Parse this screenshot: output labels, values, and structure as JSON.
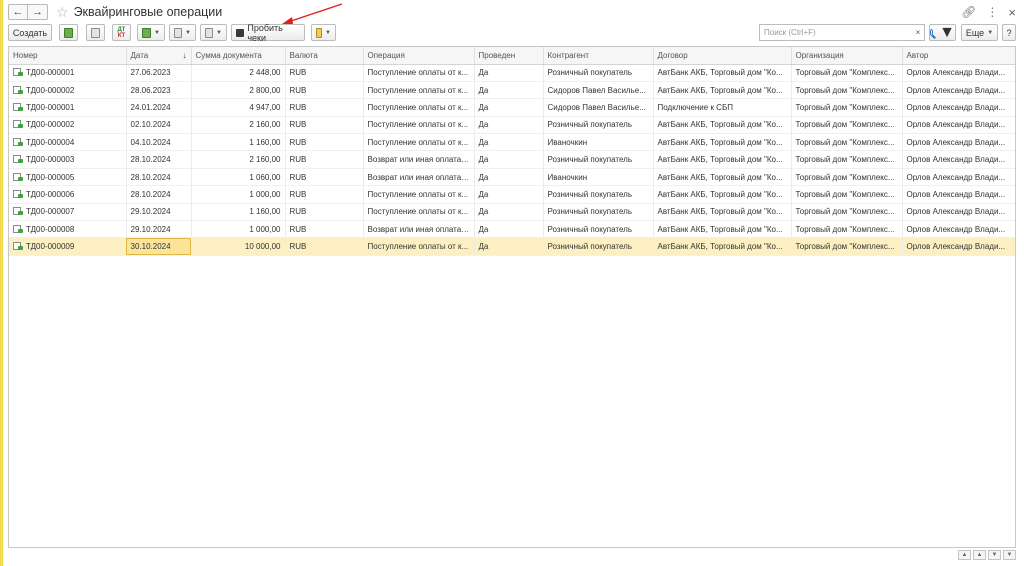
{
  "window": {
    "title": "Эквайринговые операции"
  },
  "toolbar": {
    "create_label": "Создать",
    "print_checks_label": "Пробить чеки",
    "more_label": "Еще",
    "help_label": "?",
    "search_placeholder": "Поиск (Ctrl+F)",
    "clear_label": "×"
  },
  "table": {
    "columns": [
      "Номер",
      "Дата",
      "Сумма документа",
      "Валюта",
      "Операция",
      "Проведен",
      "Контрагент",
      "Договор",
      "Организация",
      "Автор"
    ],
    "sort_indicator": "↓",
    "rows": [
      {
        "number": "ТД00-000001",
        "date": "27.06.2023",
        "sum": "2 448,00",
        "currency": "RUB",
        "operation": "Поступление оплаты от к...",
        "posted": "Да",
        "counterparty": "Розничный покупатель",
        "contract": "АвтБанк АКБ, Торговый дом \"Ко...",
        "organization": "Торговый дом \"Комплекс...",
        "author": "Орлов Александр Влади..."
      },
      {
        "number": "ТД00-000002",
        "date": "28.06.2023",
        "sum": "2 800,00",
        "currency": "RUB",
        "operation": "Поступление оплаты от к...",
        "posted": "Да",
        "counterparty": "Сидоров Павел Василье...",
        "contract": "АвтБанк АКБ, Торговый дом \"Ко...",
        "organization": "Торговый дом \"Комплекс...",
        "author": "Орлов Александр Влади..."
      },
      {
        "number": "ТД00-000001",
        "date": "24.01.2024",
        "sum": "4 947,00",
        "currency": "RUB",
        "operation": "Поступление оплаты от к...",
        "posted": "Да",
        "counterparty": "Сидоров Павел Василье...",
        "contract": "Подключение к СБП",
        "organization": "Торговый дом \"Комплекс...",
        "author": "Орлов Александр Влади..."
      },
      {
        "number": "ТД00-000002",
        "date": "02.10.2024",
        "sum": "2 160,00",
        "currency": "RUB",
        "operation": "Поступление оплаты от к...",
        "posted": "Да",
        "counterparty": "Розничный покупатель",
        "contract": "АвтБанк АКБ, Торговый дом \"Ко...",
        "organization": "Торговый дом \"Комплекс...",
        "author": "Орлов Александр Влади..."
      },
      {
        "number": "ТД00-000004",
        "date": "04.10.2024",
        "sum": "1 160,00",
        "currency": "RUB",
        "operation": "Поступление оплаты от к...",
        "posted": "Да",
        "counterparty": "Иваночкин",
        "contract": "АвтБанк АКБ, Торговый дом \"Ко...",
        "organization": "Торговый дом \"Комплекс...",
        "author": "Орлов Александр Влади..."
      },
      {
        "number": "ТД00-000003",
        "date": "28.10.2024",
        "sum": "2 160,00",
        "currency": "RUB",
        "operation": "Возврат или иная оплата ...",
        "posted": "Да",
        "counterparty": "Розничный покупатель",
        "contract": "АвтБанк АКБ, Торговый дом \"Ко...",
        "organization": "Торговый дом \"Комплекс...",
        "author": "Орлов Александр Влади..."
      },
      {
        "number": "ТД00-000005",
        "date": "28.10.2024",
        "sum": "1 060,00",
        "currency": "RUB",
        "operation": "Возврат или иная оплата ...",
        "posted": "Да",
        "counterparty": "Иваночкин",
        "contract": "АвтБанк АКБ, Торговый дом \"Ко...",
        "organization": "Торговый дом \"Комплекс...",
        "author": "Орлов Александр Влади..."
      },
      {
        "number": "ТД00-000006",
        "date": "28.10.2024",
        "sum": "1 000,00",
        "currency": "RUB",
        "operation": "Поступление оплаты от к...",
        "posted": "Да",
        "counterparty": "Розничный покупатель",
        "contract": "АвтБанк АКБ, Торговый дом \"Ко...",
        "organization": "Торговый дом \"Комплекс...",
        "author": "Орлов Александр Влади..."
      },
      {
        "number": "ТД00-000007",
        "date": "29.10.2024",
        "sum": "1 160,00",
        "currency": "RUB",
        "operation": "Поступление оплаты от к...",
        "posted": "Да",
        "counterparty": "Розничный покупатель",
        "contract": "АвтБанк АКБ, Торговый дом \"Ко...",
        "organization": "Торговый дом \"Комплекс...",
        "author": "Орлов Александр Влади..."
      },
      {
        "number": "ТД00-000008",
        "date": "29.10.2024",
        "sum": "1 000,00",
        "currency": "RUB",
        "operation": "Возврат или иная оплата ...",
        "posted": "Да",
        "counterparty": "Розничный покупатель",
        "contract": "АвтБанк АКБ, Торговый дом \"Ко...",
        "organization": "Торговый дом \"Комплекс...",
        "author": "Орлов Александр Влади..."
      },
      {
        "number": "ТД00-000009",
        "date": "30.10.2024",
        "sum": "10 000,00",
        "currency": "RUB",
        "operation": "Поступление оплаты от к...",
        "posted": "Да",
        "counterparty": "Розничный покупатель",
        "contract": "АвтБанк АКБ, Торговый дом \"Ко...",
        "organization": "Торговый дом \"Комплекс...",
        "author": "Орлов Александр Влади..."
      }
    ]
  },
  "icons": {
    "back": "arrow-left-icon",
    "forward": "arrow-right-icon",
    "favorite": "star-icon",
    "link": "link-icon",
    "menu": "kebab-menu-icon",
    "close": "close-icon",
    "document": "document-posted-icon"
  },
  "colors": {
    "selected_row": "#fcf0c3",
    "focused_cell": "#fbe39a",
    "form_stripe": "#f2d94e",
    "annotation_arrow": "#e02020"
  }
}
